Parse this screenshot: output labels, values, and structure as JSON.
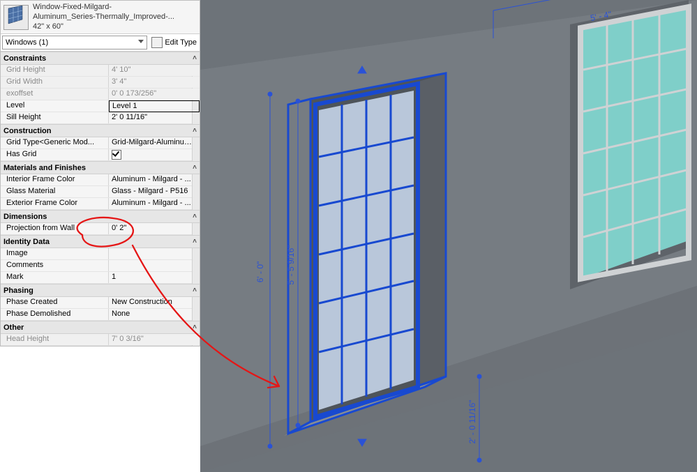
{
  "header": {
    "family_name_line1": "Window-Fixed-Milgard-",
    "family_name_line2": "Aluminum_Series-Thermally_Improved-...",
    "type_name": "42\" x 60\""
  },
  "selector": {
    "label": "Windows (1)"
  },
  "edit_type": {
    "label": "Edit Type"
  },
  "groups": {
    "constraints": {
      "title": "Constraints",
      "grid_height": {
        "label": "Grid Height",
        "value": "4'  10\""
      },
      "grid_width": {
        "label": "Grid Width",
        "value": "3'  4\""
      },
      "exoffset": {
        "label": "exoffset",
        "value": "0'  0 173/256\""
      },
      "level": {
        "label": "Level",
        "value": "Level 1"
      },
      "sill_height": {
        "label": "Sill Height",
        "value": "2'  0 11/16\""
      }
    },
    "construction": {
      "title": "Construction",
      "grid_type": {
        "label": "Grid Type<Generic Mod...",
        "value": "Grid-Milgard-Aluminum ..."
      },
      "has_grid": {
        "label": "Has Grid"
      }
    },
    "materials": {
      "title": "Materials and Finishes",
      "interior_frame": {
        "label": "Interior Frame Color",
        "value": "Aluminum - Milgard - ..."
      },
      "glass": {
        "label": "Glass Material",
        "value": "Glass - Milgard - P516"
      },
      "exterior_frame": {
        "label": "Exterior Frame Color",
        "value": "Aluminum - Milgard - ..."
      }
    },
    "dimensions": {
      "title": "Dimensions",
      "projection": {
        "label": "Projection from Wall",
        "value": "0'  2\""
      }
    },
    "identity": {
      "title": "Identity Data",
      "image": {
        "label": "Image",
        "value": ""
      },
      "comments": {
        "label": "Comments",
        "value": ""
      },
      "mark": {
        "label": "Mark",
        "value": "1"
      }
    },
    "phasing": {
      "title": "Phasing",
      "created": {
        "label": "Phase Created",
        "value": "New Construction"
      },
      "demolished": {
        "label": "Phase Demolished",
        "value": "None"
      }
    },
    "other": {
      "title": "Other",
      "head_height": {
        "label": "Head Height",
        "value": "7'  0 3/16\""
      }
    }
  },
  "viewport_dims": {
    "top": "5' - 4\"",
    "left_outer": "6' - 0\"",
    "left_inner": "5' - 5 9/16\"",
    "bottom": "2' - 0 11/16\""
  }
}
